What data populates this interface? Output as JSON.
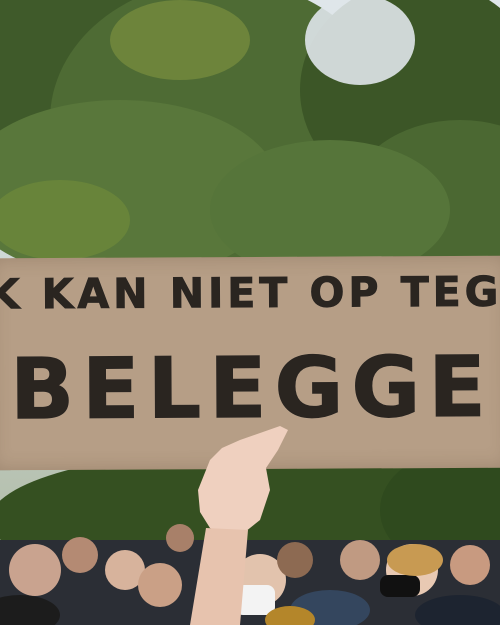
{
  "scene": {
    "description_kind": "protest photo",
    "sign": {
      "line1": "K KAN NIET OP TEGEN",
      "line2": "BELEGGERS"
    },
    "colors": {
      "cardboard": "#b69e86",
      "ink": "#2a2520",
      "foliage": "#4e6b34"
    }
  }
}
